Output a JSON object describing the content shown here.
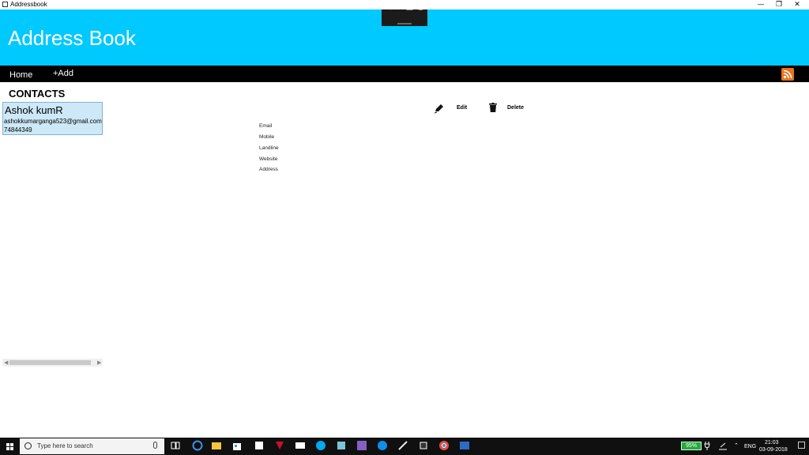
{
  "window": {
    "title": "Addressbook",
    "minimize": "—",
    "maximize": "❐",
    "close": "✕"
  },
  "header": {
    "title": "Address Book",
    "background": "#00c9ff"
  },
  "nav": {
    "home": "Home",
    "add": "+Add",
    "rss_icon": "rss-icon"
  },
  "contacts": {
    "heading": "CONTACTS",
    "items": [
      {
        "name": "Ashok kumR",
        "email": "ashokkumarganga523@gmail.com",
        "phone": "74844349"
      }
    ]
  },
  "details": {
    "edit": "Edit",
    "delete": "Delete",
    "fields": [
      "Email",
      "Mobile",
      "Landline",
      "Website",
      "Address"
    ]
  },
  "taskbar": {
    "search_placeholder": "Type here to search",
    "battery": "95%",
    "language": "ENG",
    "time": "21:03",
    "date": "03-09-2018"
  }
}
